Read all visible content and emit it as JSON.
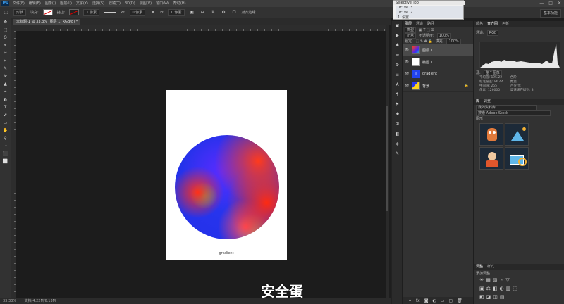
{
  "app": {
    "logo": "Ps",
    "menu": [
      "文件(F)",
      "编辑(E)",
      "图像(I)",
      "图层(L)",
      "文字(Y)",
      "选择(S)",
      "滤镜(T)",
      "3D(D)",
      "视图(V)",
      "窗口(W)",
      "帮助(H)"
    ],
    "window_controls": [
      "—",
      "□",
      "✕"
    ]
  },
  "options_bar": {
    "mode": "形状",
    "fill_label": "填充:",
    "stroke_label": "描边:",
    "stroke_width": "1 像素",
    "w_label": "W:",
    "w_value": "0 像素",
    "h_label": "H:",
    "h_value": "0 像素",
    "align_edges": "对齐边缘",
    "workspace": "基本功能"
  },
  "document": {
    "tab_label": "未标题-1 @ 33.3% (图层 1, RGB/8) *",
    "caption": "gradient",
    "zoom": "33.33%",
    "doc_info": "文档:4.22M/6.13M"
  },
  "subtitle": "安全蛋",
  "selective_tool": {
    "title": "Selective Tool",
    "line1": "Drive 3",
    "line2": "Drive 2  ...",
    "line3": "1 设置"
  },
  "layers_panel": {
    "tabs": [
      "图层",
      "通道",
      "路径"
    ],
    "kind_label": "类型",
    "blend_mode": "正常",
    "opacity_label": "不透明度:",
    "opacity_value": "100%",
    "lock_label": "锁定:",
    "fill_label": "填充:",
    "fill_value": "100%",
    "layers": [
      {
        "name": "图层 1",
        "selected": true
      },
      {
        "name": "椭圆 1",
        "selected": false
      },
      {
        "name": "gradient",
        "selected": false
      },
      {
        "name": "背景",
        "selected": false
      }
    ]
  },
  "right_panel": {
    "tabs": [
      "颜色",
      "直方图",
      "色板"
    ],
    "channel_label": "通道:",
    "channel_value": "RGB",
    "source_label": "源:",
    "source_value": "整个图像",
    "stats_left": [
      "平均值: 195.22",
      "标准偏差: 86.44",
      "中间值: 255",
      "像素: 126000"
    ],
    "stats_right": [
      "色阶:",
      "数量:",
      "百分位:",
      "高速缓存级别: 3"
    ],
    "library_tabs": [
      "库",
      "调整"
    ],
    "library_title": "我的资料库",
    "library_search": "搜索 Adobe Stock",
    "library_section": "图形",
    "adjust_tabs": [
      "调整",
      "样式"
    ],
    "adjust_title": "添加调整"
  },
  "tools": [
    "✥",
    "⬚",
    "ʘ",
    "⌖",
    "✂",
    "⌗",
    "✎",
    "⚒",
    "▲",
    "✒",
    "◐",
    "T",
    "⬈",
    "▭",
    "✋",
    "⚲",
    "⋯",
    "⬛",
    "⬜"
  ],
  "panel_icons": [
    "▣",
    "▶",
    "✱",
    "⇌",
    "⚙",
    "≡",
    "A",
    "¶",
    "⚑",
    "✚",
    "⊞",
    "◧",
    "◈",
    "✎"
  ],
  "colors": {
    "accent": "#3ea2f4",
    "subtitle": "#ffffff"
  }
}
